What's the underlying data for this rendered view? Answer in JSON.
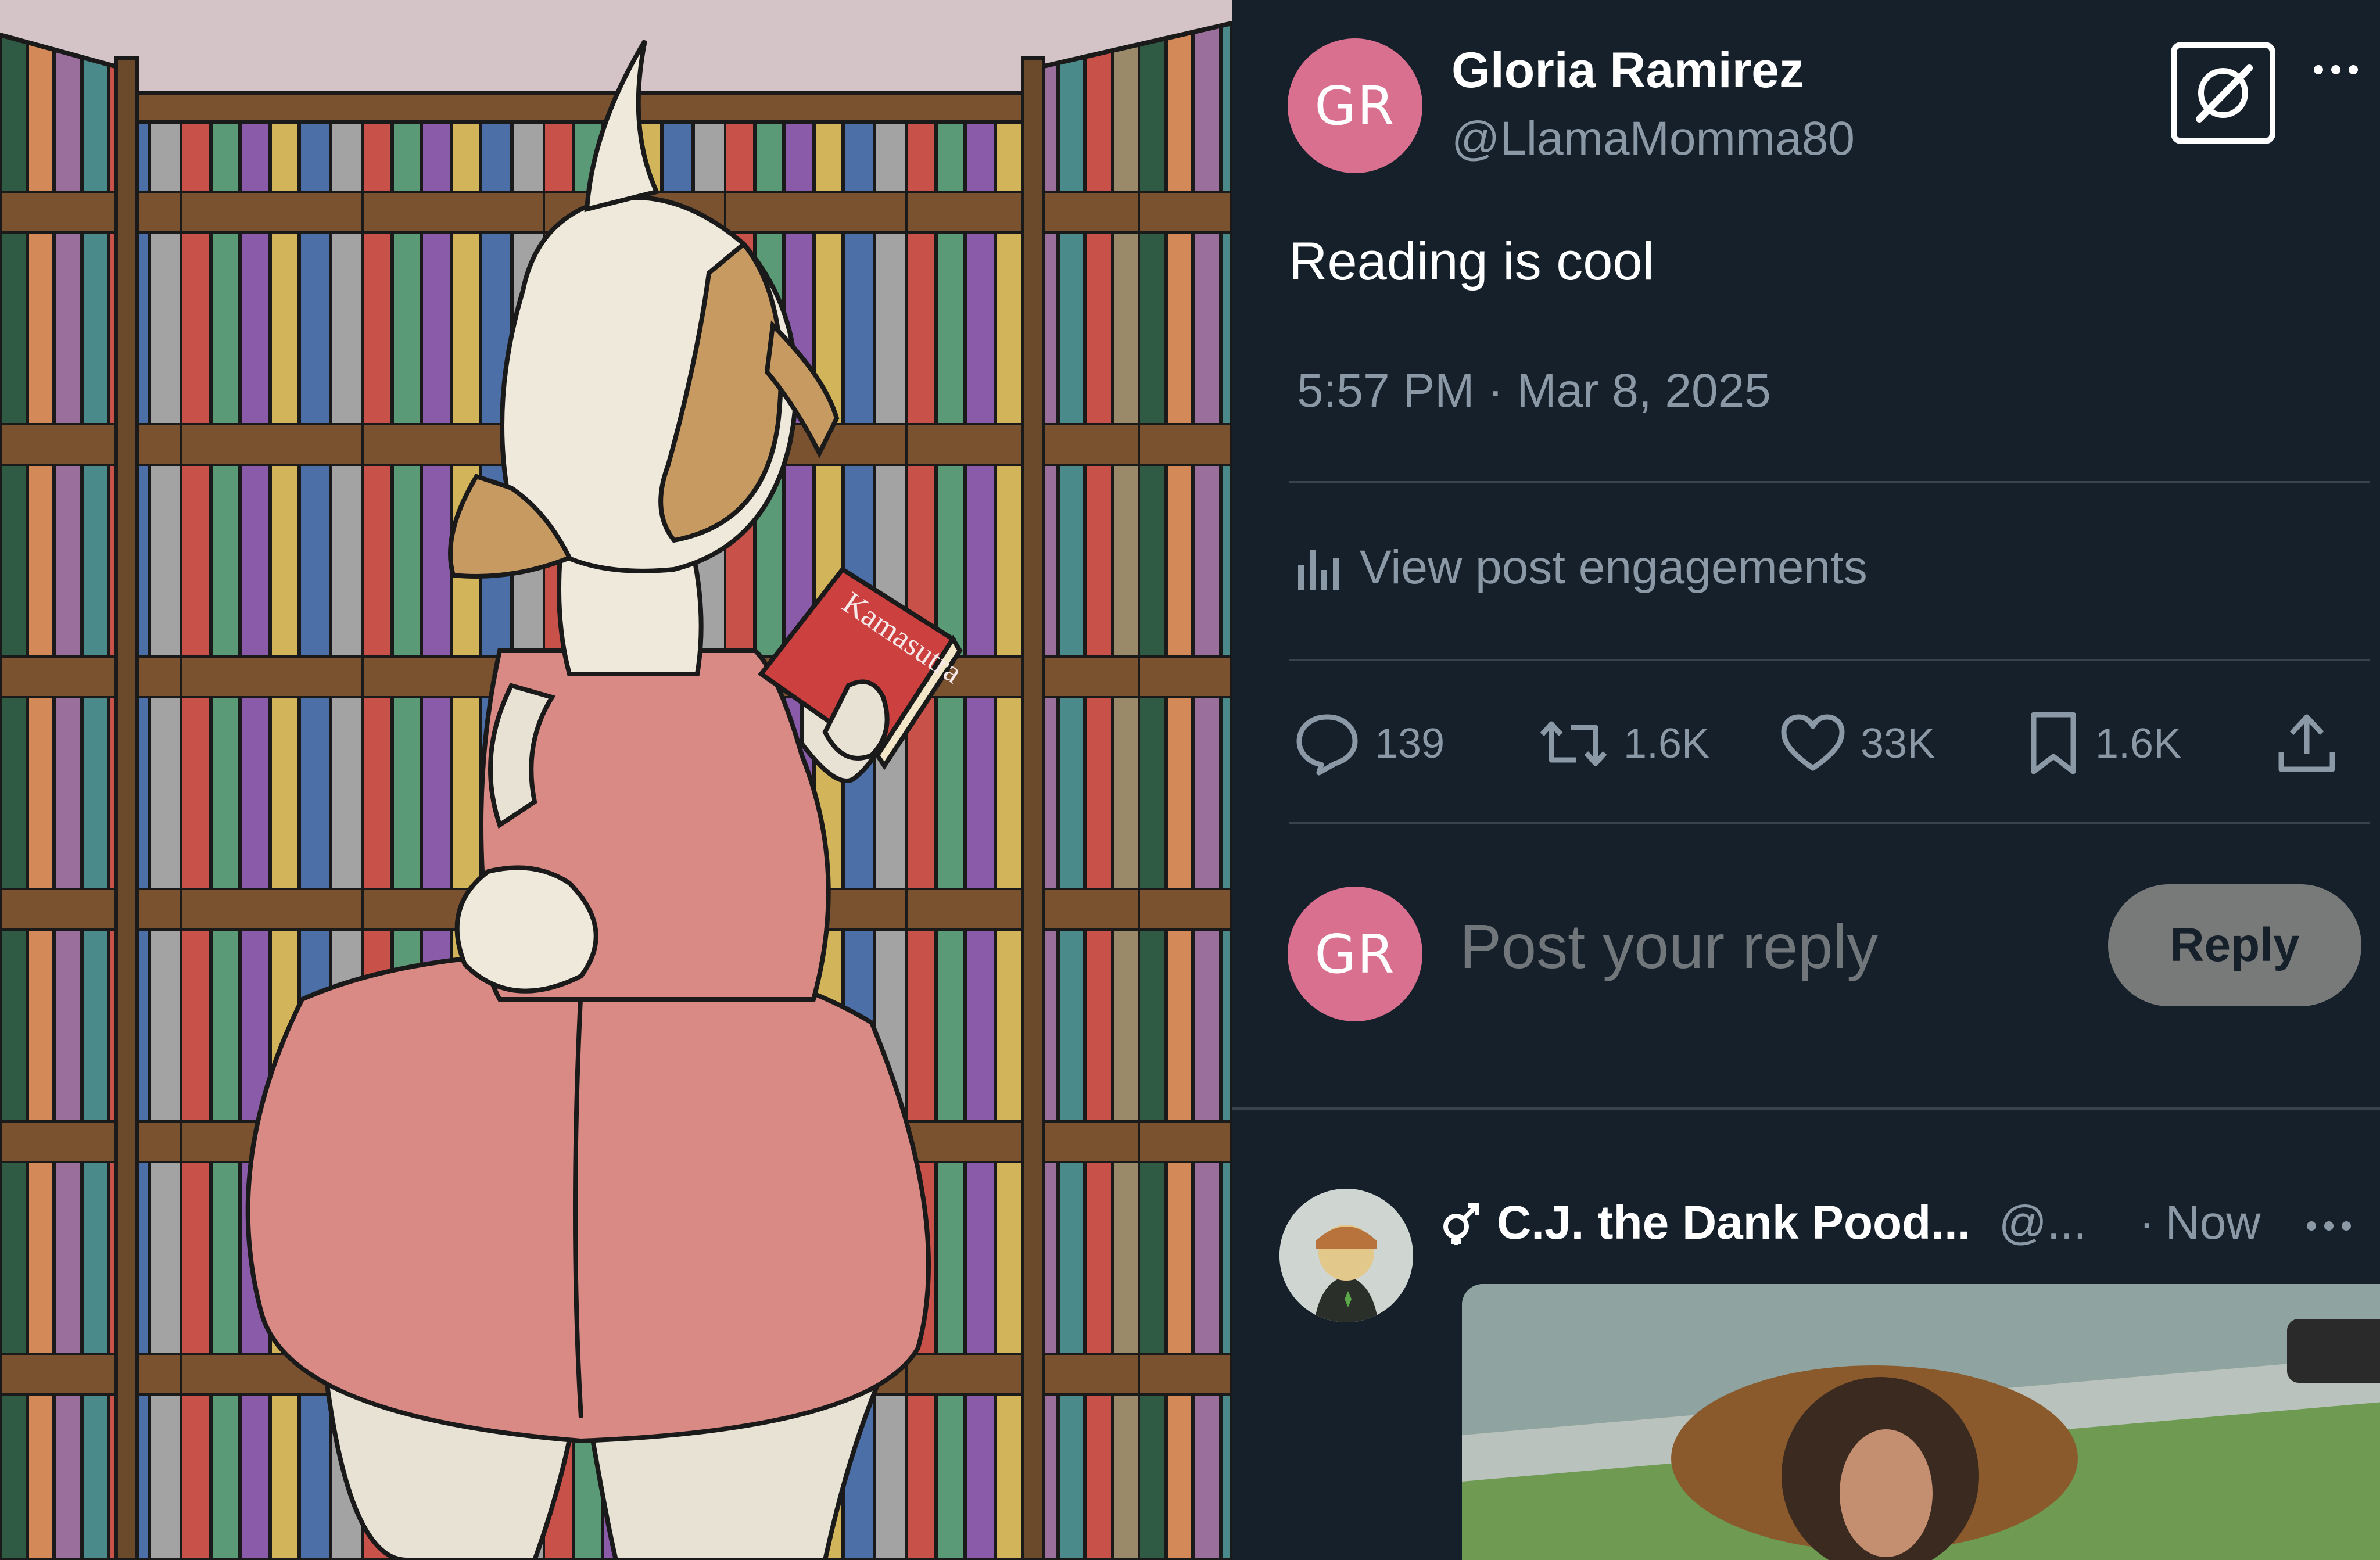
{
  "post": {
    "avatar_initials": "GR",
    "author_name": "Gloria Ramirez",
    "author_handle": "@LlamaMomma80",
    "text": "Reading is cool",
    "timestamp": "5:57 PM · Mar 8, 2025",
    "engagements_label": "View post engagements",
    "stats": {
      "replies": "139",
      "reposts": "1.6K",
      "likes": "33K",
      "bookmarks": "1.6K"
    }
  },
  "composer": {
    "avatar_initials": "GR",
    "placeholder": "Post your reply",
    "button_label": "Reply"
  },
  "reply": {
    "author_name": "C.J. the Dank Pood...",
    "author_handle": "@...",
    "separator": "·",
    "time": "Now"
  },
  "artwork": {
    "book_title": "Kamasutra"
  },
  "colors": {
    "background": "#15202b",
    "divider": "#38444d",
    "muted_text": "#8b98a5",
    "avatar": "#d9708f",
    "reply_button": "#787a7a"
  },
  "icons": [
    "grok-icon",
    "more-icon",
    "engagements-icon",
    "reply-icon",
    "repost-icon",
    "like-icon",
    "bookmark-icon",
    "share-icon",
    "gender-icon"
  ]
}
